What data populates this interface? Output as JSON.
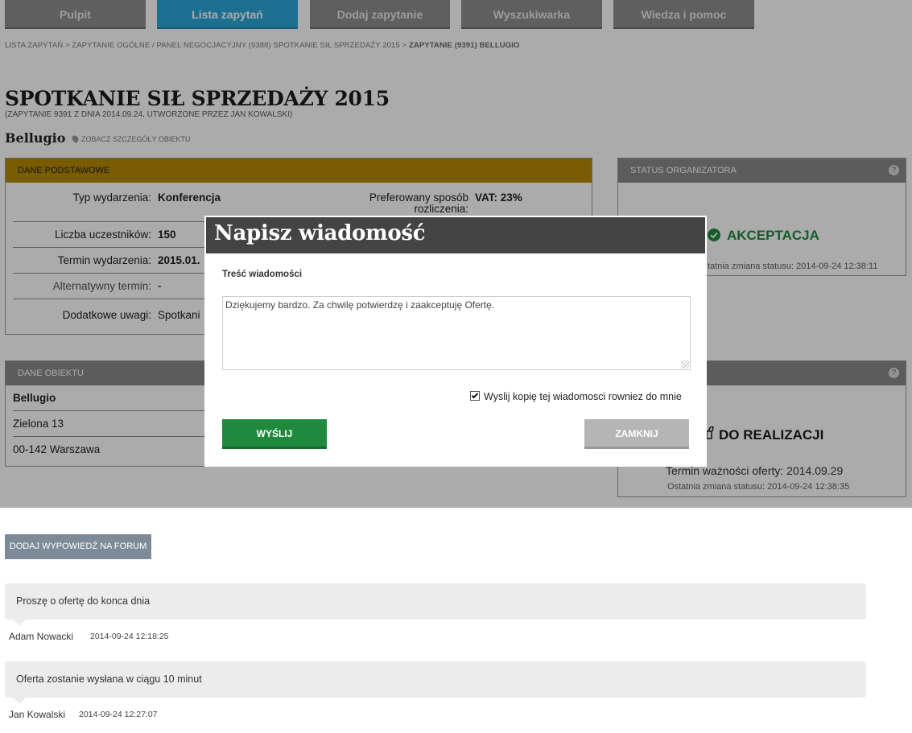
{
  "nav": {
    "tabs": [
      {
        "label": "Pulpit"
      },
      {
        "label": "Lista zapytań"
      },
      {
        "label": "Dodaj zapytanie"
      },
      {
        "label": "Wyszukiwarka"
      },
      {
        "label": "Wiedza i pomoc"
      }
    ],
    "active_index": 1
  },
  "breadcrumb": {
    "path": "LISTA ZAPYTAŃ > ZAPYTANIE OGÓLNE / PANEL NEGOCJACYJNY (9388) SPOTKANIE SIŁ SPRZEDAŻY 2015 > ",
    "current": "ZAPYTANIE (9391) BELLUGIO"
  },
  "header": {
    "title": "SPOTKANIE SIŁ SPRZEDAŻY 2015",
    "subtitle": "(ZAPYTANIE 9391 Z DNIA 2014.09.24, UTWORZONE PRZEZ JAN KOWALSKI)",
    "venue": "Bellugio",
    "venue_link": "ZOBACZ SZCZEGÓŁY OBIEKTU"
  },
  "basic": {
    "title": "DANE PODSTAWOWE",
    "rows": [
      {
        "label": "Typ wydarzenia:",
        "value": "Konferencja"
      },
      {
        "label": "Liczba uczestników:",
        "value": "150"
      },
      {
        "label": "Termin wydarzenia:",
        "value": "2015.01."
      },
      {
        "label": "Alternatywny termin:",
        "value": "-"
      },
      {
        "label": "Dodatkowe uwagi:",
        "value": "Spotkani"
      }
    ],
    "billing_label_1": "Preferowany sposób",
    "billing_label_2": "rozliczenia:",
    "billing_value": "VAT: 23%"
  },
  "organizer_status": {
    "title": "STATUS ORGANIZATORA",
    "status": "AKCEPTACJA",
    "changed": "tatnia zmiana statusu: 2014-09-24 12:38:11",
    "status_color": "#1f8a3e"
  },
  "venue_data": {
    "title": "DANE OBIEKTU",
    "name": "Bellugio",
    "street": "Zielona 13",
    "city": "00-142 Warszawa"
  },
  "offer_status": {
    "status": "DO REALIZACJI",
    "validity": "Termin ważności oferty: 2014.09.29",
    "changed": "Ostatnia zmiana statusu: 2014-09-24 12:38:35"
  },
  "forum": {
    "add_label": "DODAJ WYPOWIEDŹ NA FORUM",
    "posts": [
      {
        "text": "Proszę o ofertę do konca dnia",
        "author": "Adam Nowacki",
        "time": "2014-09-24 12:18:25"
      },
      {
        "text": "Oferta zostanie wysłana w ciągu 10 minut",
        "author": "Jan Kowalski",
        "time": "2014-09-24 12:27:07"
      }
    ]
  },
  "modal": {
    "title": "Napisz wiadomość",
    "field_label": "Treść wiadomości",
    "message": "Dziękujemy bardzo. Za chwilę potwierdzę i zaakceptuję Ofertę.",
    "copy_label": "Wyslij kopię tej wiadomosci rowniez do mnie",
    "copy_checked": true,
    "send_label": "WYŚLIJ",
    "close_label": "ZAMKNIJ"
  },
  "colors": {
    "accent_blue": "#2ca6d9",
    "gold": "#b58a00",
    "green": "#1f8a3e"
  }
}
